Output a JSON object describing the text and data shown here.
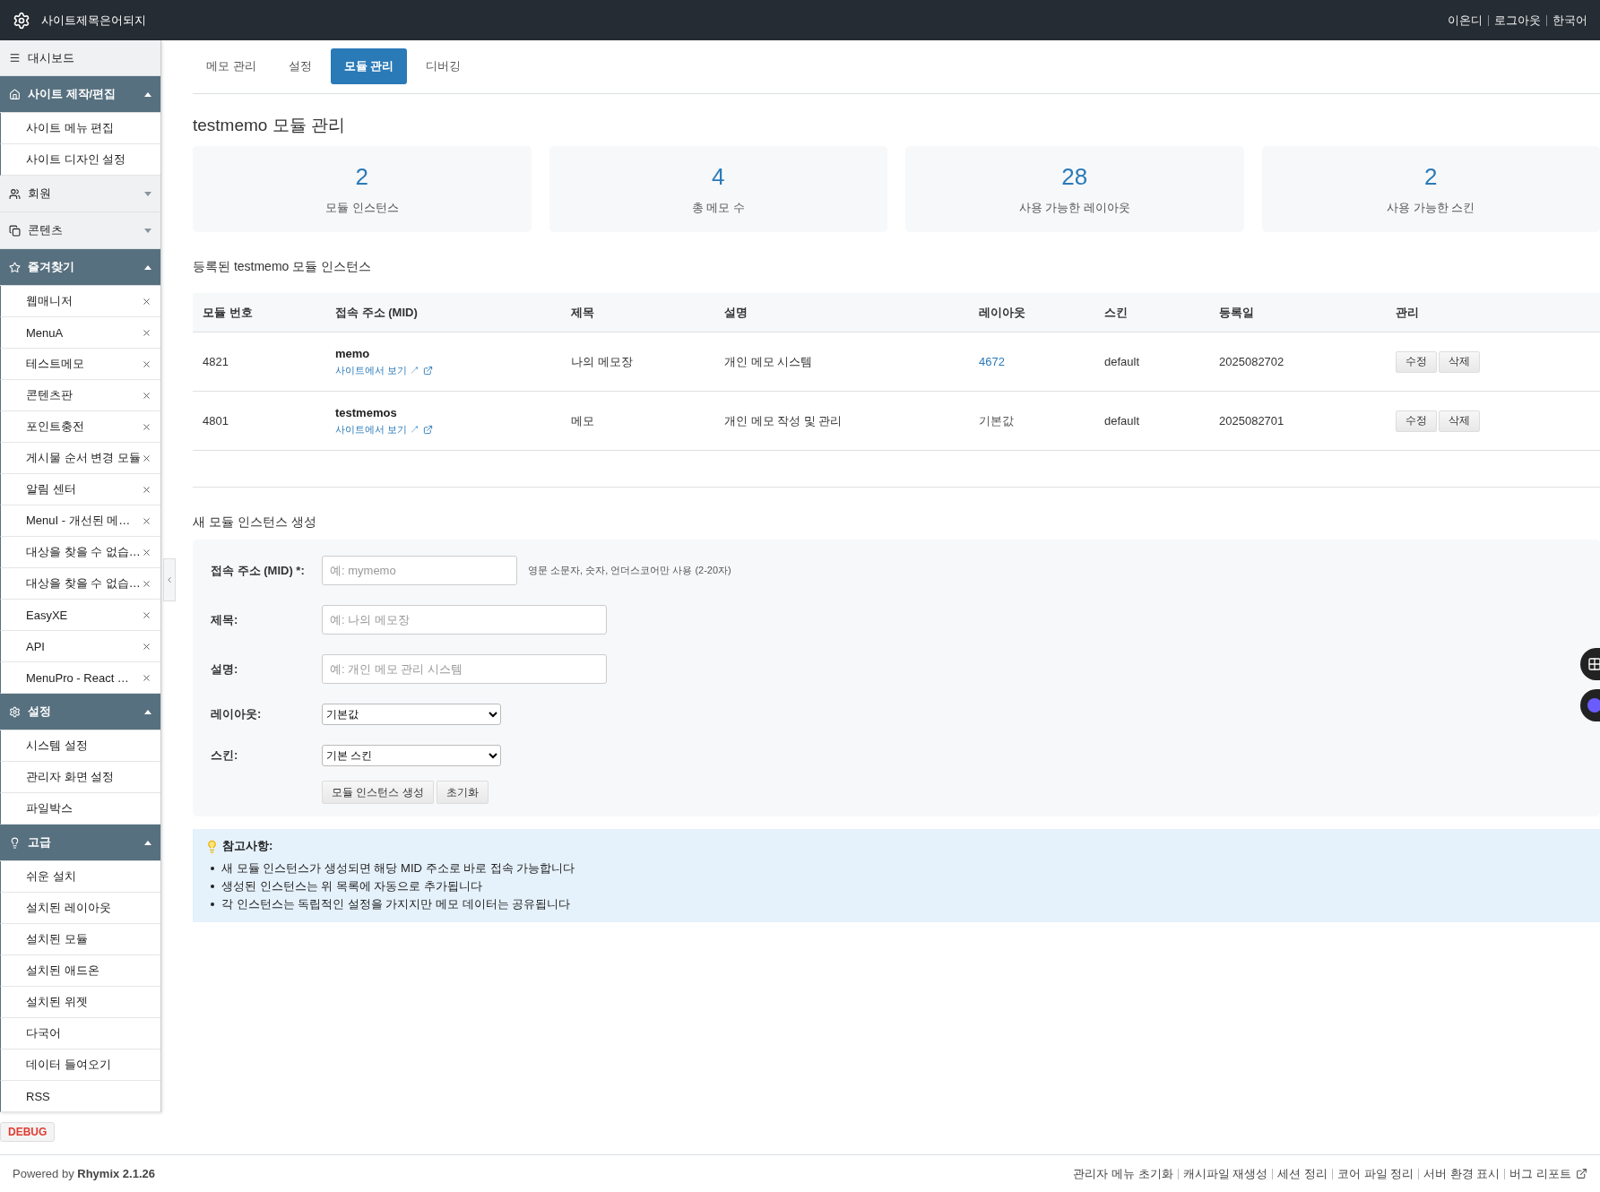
{
  "header": {
    "site_title": "사이트제목은어되지",
    "user_links": [
      "이온디",
      "로그아웃",
      "한국어"
    ]
  },
  "sidebar": {
    "items": [
      {
        "kind": "link",
        "label": "대시보드"
      },
      {
        "kind": "group",
        "label": "사이트 제작/편집",
        "expanded": true,
        "items": [
          {
            "label": "사이트 메뉴 편집",
            "removable": false
          },
          {
            "label": "사이트 디자인 설정",
            "removable": false
          }
        ]
      },
      {
        "kind": "group",
        "label": "회원",
        "expanded": false
      },
      {
        "kind": "group",
        "label": "콘텐츠",
        "expanded": false
      },
      {
        "kind": "group",
        "label": "즐겨찾기",
        "expanded": true,
        "items": [
          {
            "label": "웹매니저",
            "removable": true
          },
          {
            "label": "MenuA",
            "removable": true
          },
          {
            "label": "테스트메모",
            "removable": true
          },
          {
            "label": "콘텐츠판",
            "removable": true
          },
          {
            "label": "포인트충전",
            "removable": true
          },
          {
            "label": "게시물 순서 변경 모듈",
            "removable": true
          },
          {
            "label": "알림 센터",
            "removable": true
          },
          {
            "label": "MenuI - 개선된 메…",
            "removable": true
          },
          {
            "label": "대상을 찾을 수 없습…",
            "removable": true
          },
          {
            "label": "대상을 찾을 수 없습…",
            "removable": true
          },
          {
            "label": "EasyXE",
            "removable": true
          },
          {
            "label": "API",
            "removable": true
          },
          {
            "label": "MenuPro - React …",
            "removable": true
          }
        ]
      },
      {
        "kind": "group",
        "label": "설정",
        "expanded": true,
        "items": [
          {
            "label": "시스템 설정",
            "removable": false
          },
          {
            "label": "관리자 화면 설정",
            "removable": false
          },
          {
            "label": "파일박스",
            "removable": false
          }
        ]
      },
      {
        "kind": "group",
        "label": "고급",
        "expanded": true,
        "items": [
          {
            "label": "쉬운 설치",
            "removable": false
          },
          {
            "label": "설치된 레이아웃",
            "removable": false
          },
          {
            "label": "설치된 모듈",
            "removable": false
          },
          {
            "label": "설치된 애드온",
            "removable": false
          },
          {
            "label": "설치된 위젯",
            "removable": false
          },
          {
            "label": "다국어",
            "removable": false
          },
          {
            "label": "데이터 들여오기",
            "removable": false
          },
          {
            "label": "RSS",
            "removable": false
          }
        ]
      }
    ],
    "debug": "DEBUG"
  },
  "tabs": [
    {
      "label": "메모 관리",
      "selected": false
    },
    {
      "label": "설정",
      "selected": false
    },
    {
      "label": "모듈 관리",
      "selected": true
    },
    {
      "label": "디버깅",
      "selected": false
    }
  ],
  "page_title": "testmemo 모듈 관리",
  "stats": [
    {
      "value": "2",
      "label": "모듈 인스턴스"
    },
    {
      "value": "4",
      "label": "총 메모 수"
    },
    {
      "value": "28",
      "label": "사용 가능한 레이아웃"
    },
    {
      "value": "2",
      "label": "사용 가능한 스킨"
    }
  ],
  "instances": {
    "heading": "등록된 testmemo 모듈 인스턴스",
    "columns": [
      "모듈 번호",
      "접속 주소 (MID)",
      "제목",
      "설명",
      "레이아웃",
      "스킨",
      "등록일",
      "관리"
    ],
    "rows": [
      {
        "number": "4821",
        "mid": "memo",
        "view_link": "사이트에서 보기 ↗",
        "title": "나의 메모장",
        "description": "개인 메모 시스템",
        "layout": {
          "kind": "link",
          "text": "4672"
        },
        "skin": "default",
        "date": "2025082702",
        "actions": [
          "수정",
          "삭제"
        ]
      },
      {
        "number": "4801",
        "mid": "testmemos",
        "view_link": "사이트에서 보기 ↗",
        "title": "메모",
        "description": "개인 메모 작성 및 관리",
        "layout": {
          "kind": "text",
          "text": "기본값"
        },
        "skin": "default",
        "date": "2025082701",
        "actions": [
          "수정",
          "삭제"
        ]
      }
    ]
  },
  "create_form": {
    "heading": "새 모듈 인스턴스 생성",
    "fields": [
      {
        "kind": "input",
        "label": "접속 주소 (MID) *:",
        "placeholder": "예: mymemo",
        "hint": "영문 소문자, 숫자, 언더스코어만 사용 (2-20자)"
      },
      {
        "kind": "input",
        "label": "제목:",
        "placeholder": "예: 나의 메모장"
      },
      {
        "kind": "input",
        "label": "설명:",
        "placeholder": "예: 개인 메모 관리 시스템"
      },
      {
        "kind": "select",
        "label": "레이아웃:",
        "value": "기본값"
      },
      {
        "kind": "select",
        "label": "스킨:",
        "value": "기본 스킨"
      }
    ],
    "buttons": [
      "모듈 인스턴스 생성",
      "초기화"
    ]
  },
  "notes": {
    "title": "참고사항:",
    "items": [
      "새 모듈 인스턴스가 생성되면 해당 MID 주소로 바로 접속 가능합니다",
      "생성된 인스턴스는 위 목록에 자동으로 추가됩니다",
      "각 인스턴스는 독립적인 설정을 가지지만 메모 데이터는 공유됩니다"
    ]
  },
  "footer": {
    "powered": "Powered by **Rhymix 2.1.26**",
    "links": [
      "관리자 메뉴 초기화",
      "캐시파일 재생성",
      "세션 정리",
      "코어 파일 정리",
      "서버 환경 표시",
      "버그 리포트"
    ]
  }
}
